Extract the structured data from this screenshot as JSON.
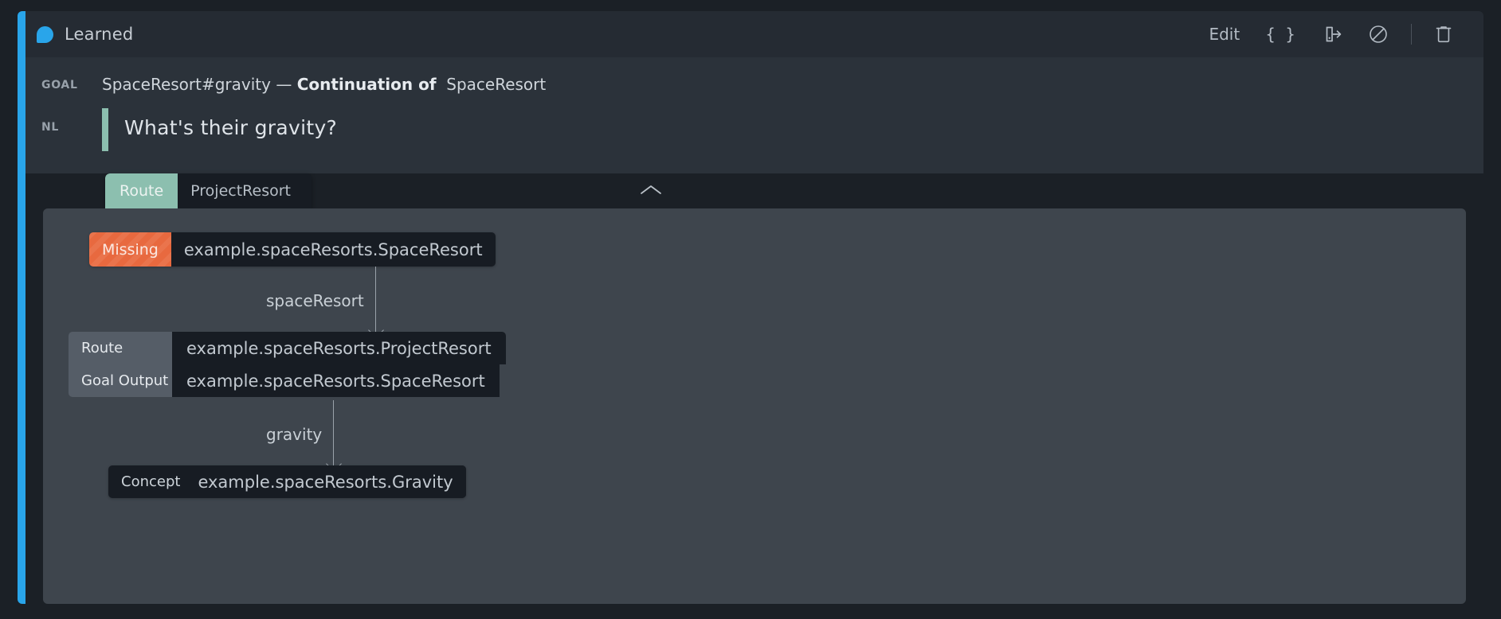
{
  "window": {
    "accent_color": "#29a5ea",
    "title": "Learned",
    "brand_icon": "learned-dot-icon"
  },
  "header_actions": [
    {
      "name": "edit-button",
      "label": "Edit",
      "icon": null,
      "type": "text"
    },
    {
      "name": "json-button",
      "label": "{ }",
      "icon": "braces-icon",
      "type": "text"
    },
    {
      "name": "export-button",
      "label": "",
      "icon": "export-icon",
      "type": "icon"
    },
    {
      "name": "disable-button",
      "label": "",
      "icon": "ban-icon",
      "type": "icon"
    },
    {
      "name": "delete-button",
      "label": "",
      "icon": "trash-icon",
      "type": "icon"
    }
  ],
  "meta": {
    "goal_label": "GOAL",
    "goal_subject": "SpaceResort#gravity",
    "goal_separator": "—",
    "goal_relation": "Continuation of",
    "goal_object": "SpaceResort",
    "nl_label": "NL",
    "nl_text": "What's their gravity?"
  },
  "tab": {
    "kind": "Route",
    "name": "ProjectResort",
    "collapse_icon": "chevron-up-icon",
    "active_color": "#8cbfaf"
  },
  "graph": {
    "nodes": [
      {
        "id": "missing-spaceresort",
        "style": "missing",
        "label": "Missing",
        "value": "example.spaceResorts.SpaceResort",
        "badge_color": "#e8693f"
      },
      {
        "id": "route-projectresort",
        "style": "table",
        "rows": [
          {
            "key": "Route",
            "value": "example.spaceResorts.ProjectResort"
          },
          {
            "key": "Goal Output",
            "value": "example.spaceResorts.SpaceResort"
          }
        ]
      },
      {
        "id": "concept-gravity",
        "style": "concept",
        "label": "Concept",
        "value": "example.spaceResorts.Gravity"
      }
    ],
    "edges": [
      {
        "from": "missing-spaceresort",
        "to": "route-projectresort",
        "label": "spaceResort"
      },
      {
        "from": "route-projectresort",
        "to": "concept-gravity",
        "label": "gravity"
      }
    ]
  }
}
